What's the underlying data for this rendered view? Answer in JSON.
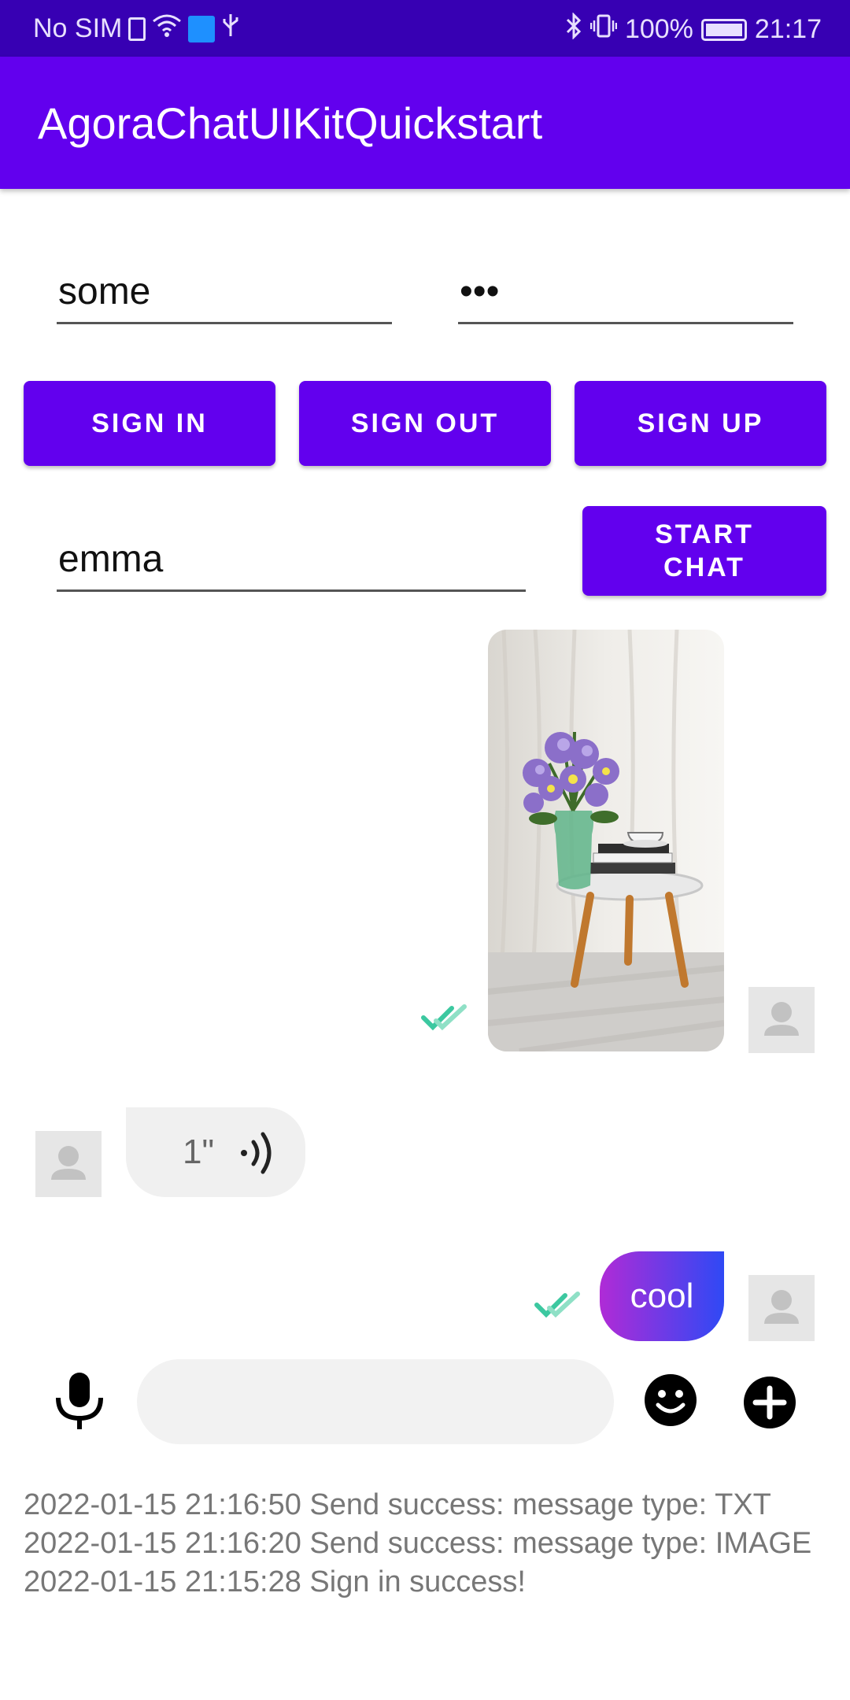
{
  "status_bar": {
    "carrier": "No SIM",
    "battery": "100%",
    "time": "21:17"
  },
  "app_bar": {
    "title": "AgoraChatUIKitQuickstart"
  },
  "login": {
    "username_value": "some",
    "password_value": "•••",
    "sign_in_label": "SIGN IN",
    "sign_out_label": "SIGN OUT",
    "sign_up_label": "SIGN UP"
  },
  "chat_target": {
    "user_value": "emma",
    "start_chat_label": "START\nCHAT"
  },
  "messages": {
    "voice_duration": "1\"",
    "text_message": "cool"
  },
  "colors": {
    "primary": "#6200ee",
    "primary_dark": "#3700b3",
    "read_check": "#3cc8a0",
    "bubble_gradient_start": "#b02bd6",
    "bubble_gradient_end": "#2f49f5"
  },
  "icons": {
    "voice_record": "microphone-icon",
    "emoji": "smiley-icon",
    "more": "plus-circle-icon",
    "read_receipt": "double-check-icon",
    "avatar": "person-icon"
  },
  "log": [
    "2022-01-15 21:16:50 Send success: message type: TXT",
    "2022-01-15 21:16:20 Send success: message type: IMAGE",
    "2022-01-15 21:15:28 Sign in success!"
  ]
}
